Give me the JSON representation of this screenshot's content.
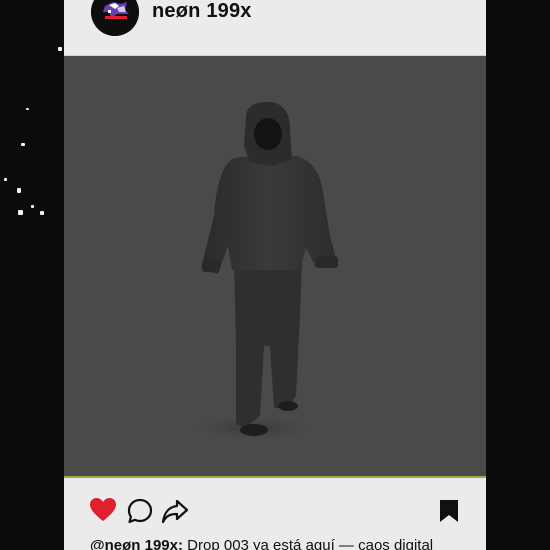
{
  "post": {
    "username": "neøn 199x",
    "avatar_icon": "neon-logo-icon",
    "caption_handle": "@neøn 199x:",
    "caption_text": " Drop 003 ya está aquí — caos digital"
  },
  "actions": {
    "like_icon": "heart-icon",
    "comment_icon": "comment-icon",
    "share_icon": "share-icon",
    "save_icon": "bookmark-icon",
    "like_color": "#e0202e"
  },
  "colors": {
    "page_background": "#0b0b0b",
    "card_background": "#ebebeb",
    "photo_background": "#4a4a4d",
    "accent_line": "#8fb33a"
  }
}
